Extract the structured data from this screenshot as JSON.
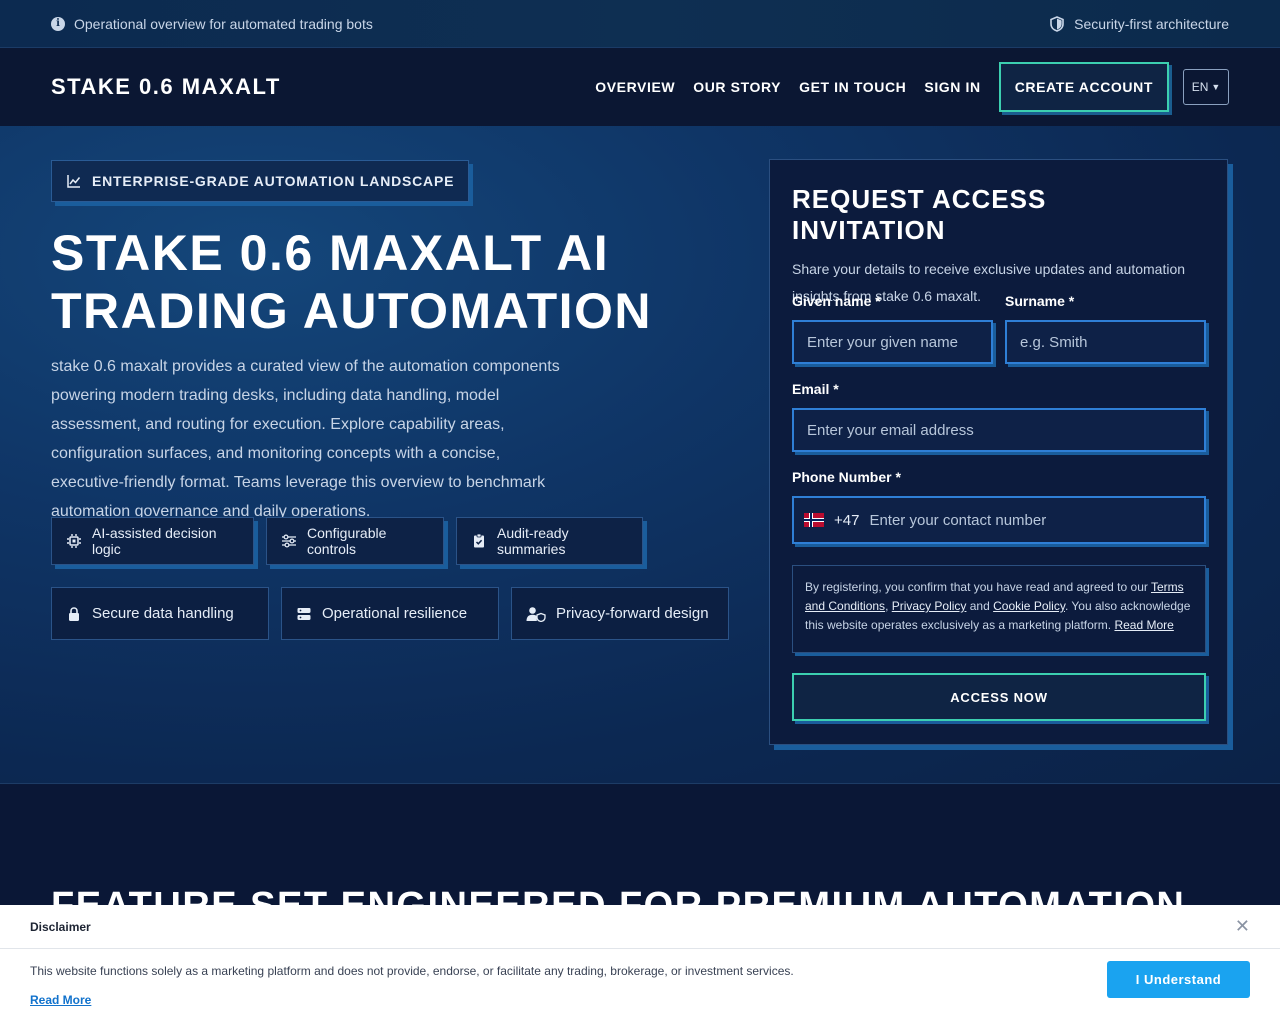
{
  "topbar": {
    "left_text": "Operational overview for automated trading bots",
    "right_text": "Security-first architecture"
  },
  "header": {
    "logo": "STAKE 0.6 MAXALT",
    "nav": [
      "OVERVIEW",
      "OUR STORY",
      "GET IN TOUCH",
      "SIGN IN"
    ],
    "create_account": "CREATE ACCOUNT",
    "language": "EN"
  },
  "hero": {
    "eyebrow": "ENTERPRISE-GRADE AUTOMATION LANDSCAPE",
    "title": "STAKE 0.6 MAXALT AI TRADING AUTOMATION",
    "lead": "stake 0.6 maxalt provides a curated view of the automation components powering modern trading desks, including data handling, model assessment, and routing for execution. Explore capability areas, configuration surfaces, and monitoring concepts with a concise, executive-friendly format. Teams leverage this overview to benchmark automation governance and daily operations.",
    "chips_row1": [
      "AI-assisted decision logic",
      "Configurable controls",
      "Audit-ready summaries"
    ],
    "chips_row2": [
      "Secure data handling",
      "Operational resilience",
      "Privacy-forward design"
    ]
  },
  "form": {
    "title": "REQUEST ACCESS INVITATION",
    "subtitle": "Share your details to receive exclusive updates and automation insights from stake 0.6 maxalt.",
    "given_name_label": "Given name *",
    "given_name_placeholder": "Enter your given name",
    "surname_label": "Surname *",
    "surname_placeholder": "e.g. Smith",
    "email_label": "Email *",
    "email_placeholder": "Enter your email address",
    "phone_label": "Phone Number *",
    "phone_code": "+47",
    "phone_placeholder": "Enter your contact number",
    "consent_pre": "By registering, you confirm that you have read and agreed to our ",
    "terms": "Terms and Conditions",
    "comma": ", ",
    "privacy": "Privacy Policy",
    "and": " and ",
    "cookie": "Cookie Policy",
    "consent_post": ". You also acknowledge this website operates exclusively as a marketing platform. ",
    "read_more": "Read More",
    "submit": "ACCESS NOW"
  },
  "section2": {
    "title": "FEATURE SET ENGINEERED FOR PREMIUM AUTOMATION"
  },
  "disclaimer": {
    "title": "Disclaimer",
    "text": "This website functions solely as a marketing platform and does not provide, endorse, or facilitate any trading, brokerage, or investment services.",
    "read_more": "Read More",
    "button": "I Understand"
  },
  "colors": {
    "accent_teal": "#3ccfb0",
    "accent_blue": "#2f7fd6",
    "understand_button": "#1aa3f0"
  }
}
